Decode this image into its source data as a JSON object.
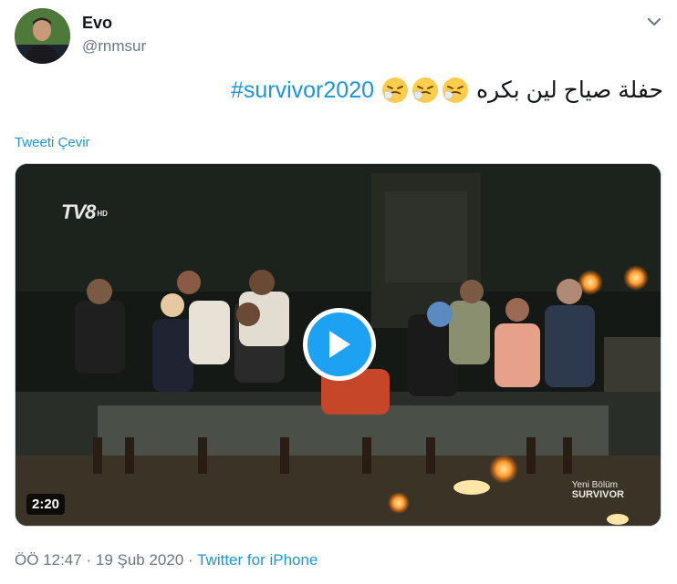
{
  "user": {
    "display_name": "Evo",
    "handle": "@rnmsur"
  },
  "tweet": {
    "text": "حفلة صياح لين بكره",
    "hashtag": "#survivor2020",
    "emoji": [
      "sneezing-face",
      "sneezing-face",
      "sneezing-face"
    ],
    "translate_label": "Tweeti Çevir"
  },
  "media": {
    "duration": "2:20",
    "channel_logo": "TV8",
    "channel_logo_suffix": "HD",
    "caption_line1": "Yeni Bölüm",
    "caption_line2": "SURVIVOR"
  },
  "meta": {
    "time": "ÖÖ 12:47",
    "separator1": "·",
    "date": "19 Şub 2020",
    "separator2": "·",
    "source": "Twitter for iPhone"
  },
  "colors": {
    "link": "#1b95e0",
    "secondary_text": "#657786",
    "play_button": "#1da1f2"
  }
}
